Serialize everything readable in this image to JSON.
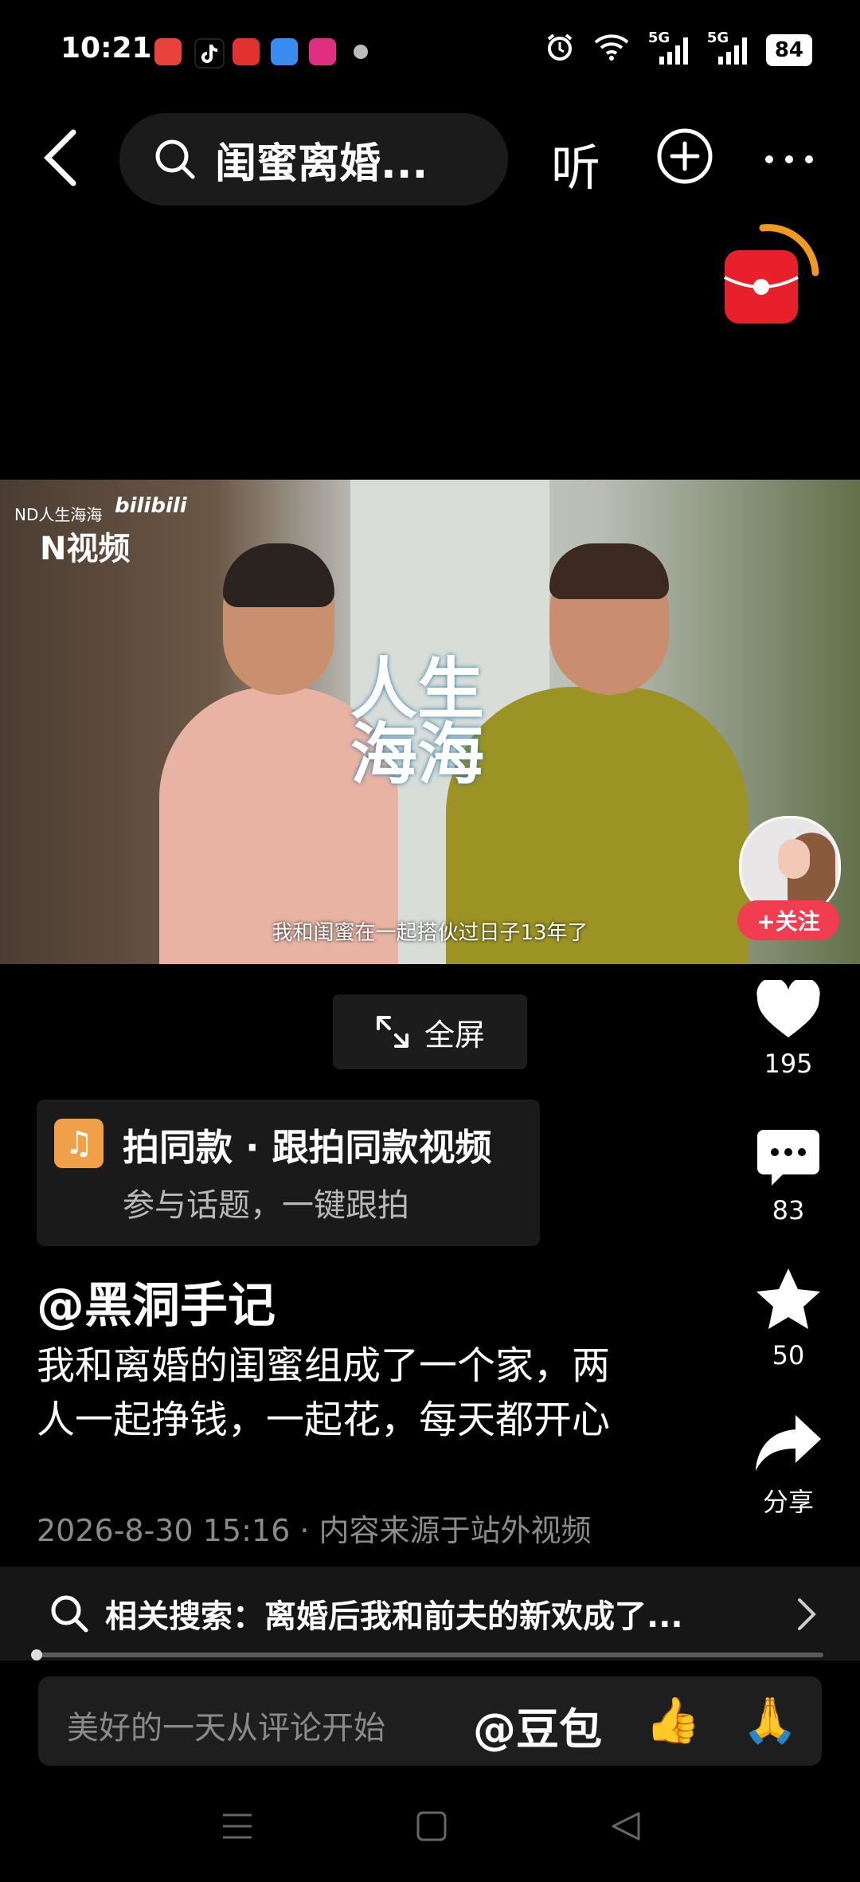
{
  "status_bar": {
    "time": "10:21",
    "signal_1": "5G",
    "signal_2": "5G",
    "battery": "84",
    "icons": [
      "alarm-icon",
      "wifi-icon",
      "signal-icon",
      "signal-icon",
      "battery-icon"
    ]
  },
  "top_bar": {
    "search_text": "闺蜜离婚...",
    "listen_label": "听"
  },
  "video": {
    "watermark_small": "ND人生海海",
    "watermark_brand": "bilibili",
    "watermark_big": "N视频",
    "title_art": "人生\n海海",
    "subtitle": "我和闺蜜在一起搭伙过日子13年了"
  },
  "follow_label": "+关注",
  "fullscreen_label": "全屏",
  "actions": {
    "likes": "195",
    "comments": "83",
    "favorites": "50",
    "share_label": "分享"
  },
  "template_card": {
    "title": "拍同款 · 跟拍同款视频",
    "subtitle": "参与话题，一键跟拍"
  },
  "post": {
    "author": "@黑洞手记",
    "description": "我和离婚的闺蜜组成了一个家，两人一起挣钱，一起花，每天都开心",
    "meta": "2026-8-30 15:16 · 内容来源于站外视频"
  },
  "related_search": {
    "label": "相关搜索：离婚后我和前夫的新欢成了..."
  },
  "comment_bar": {
    "placeholder": "美好的一天从评论开始",
    "mention": "@豆包",
    "emoji_1": "👍",
    "emoji_2": "🙏"
  },
  "colors": {
    "accent_red": "#f23c4f",
    "background": "#000000"
  }
}
